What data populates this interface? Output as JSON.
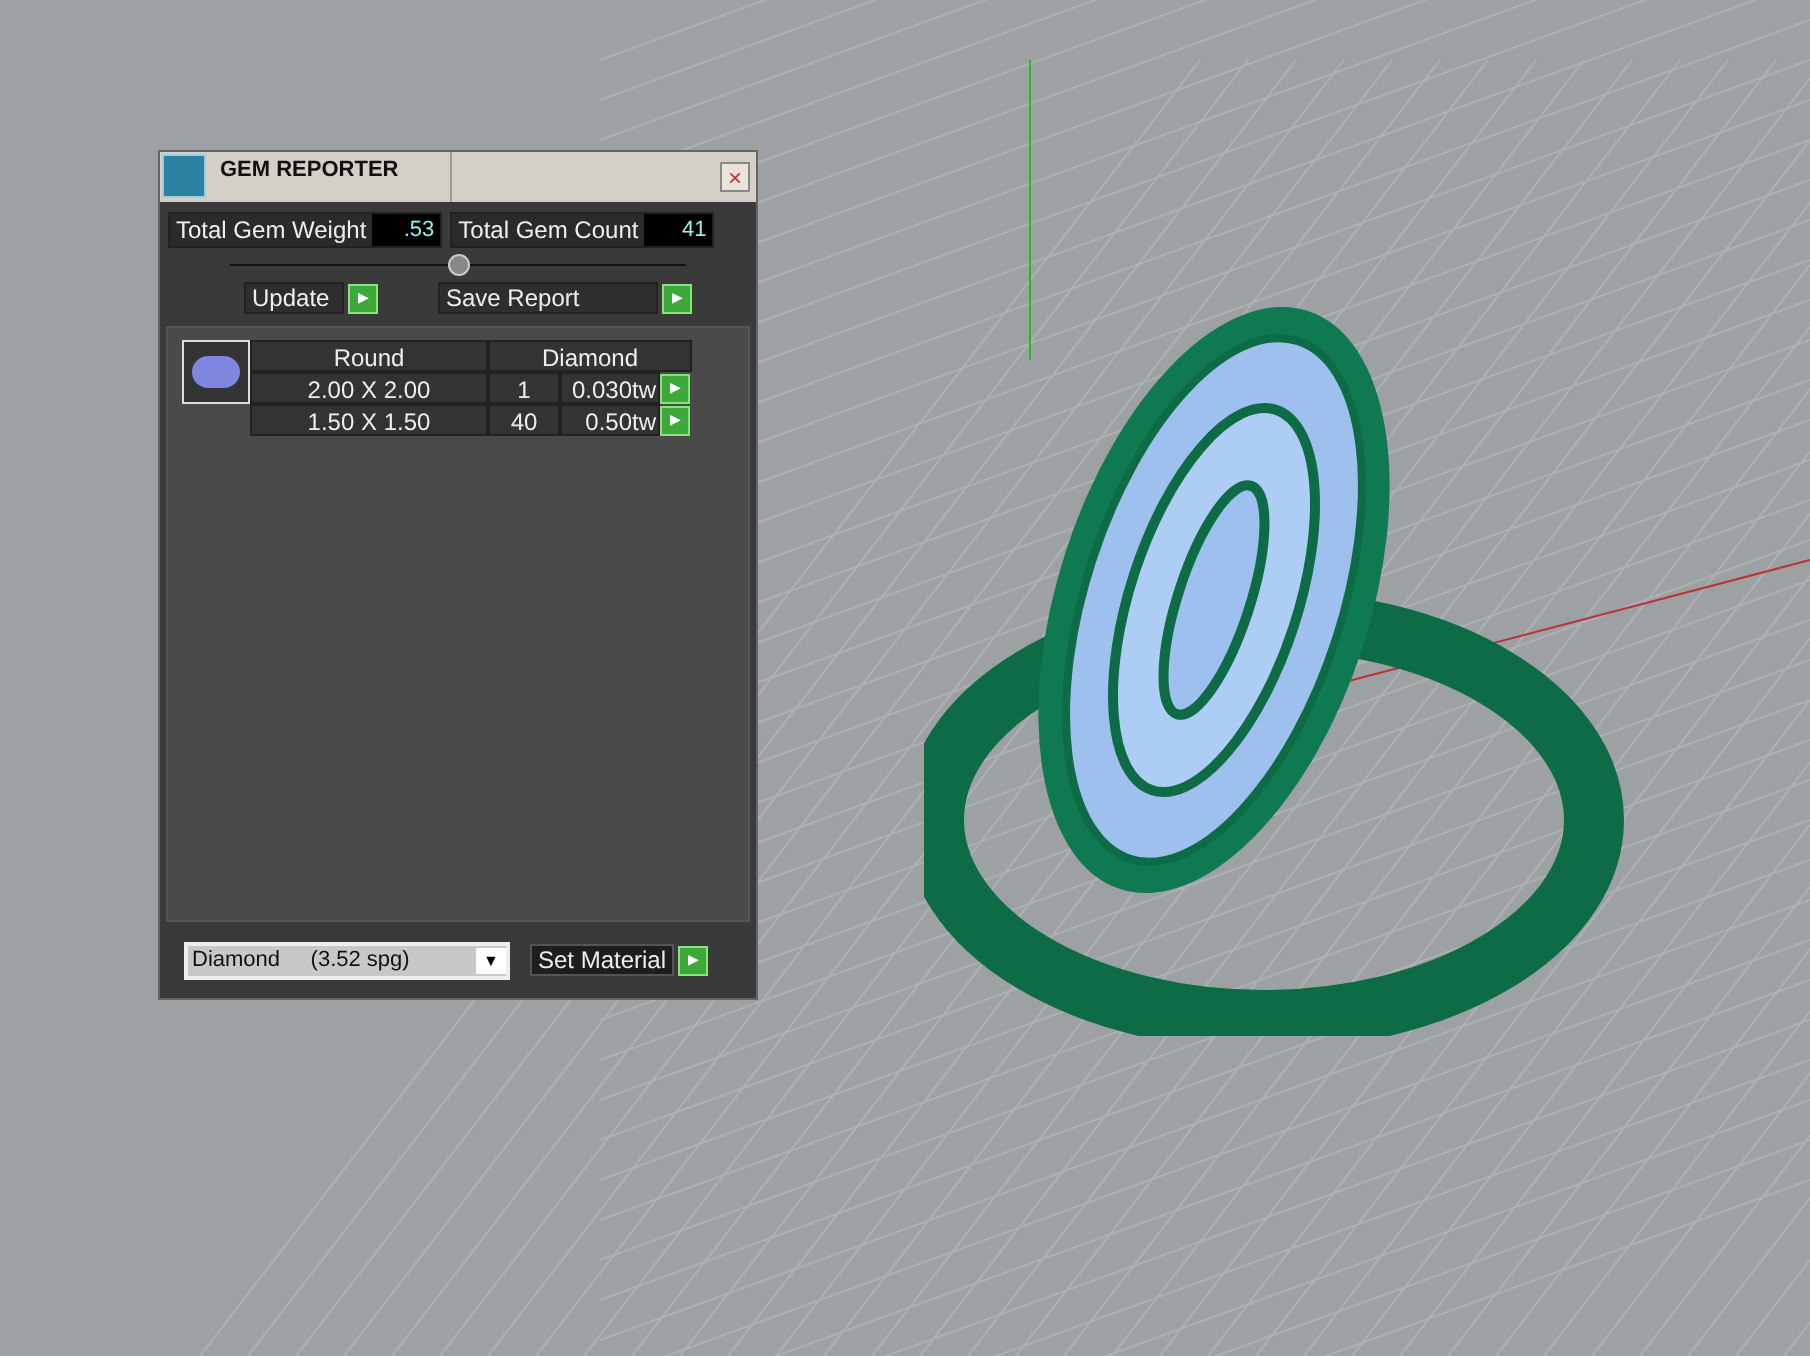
{
  "panel": {
    "title": "GEM REPORTER",
    "close": "×"
  },
  "totals": [
    {
      "label": "Total Gem Weight",
      "value": ".53"
    },
    {
      "label": "Total Gem Count",
      "value": "41"
    }
  ],
  "buttons": [
    {
      "label": "Update",
      "arrow": "▶"
    },
    {
      "label": "Save Report",
      "arrow": "▶"
    }
  ],
  "table": {
    "columns": [
      "Round",
      "Diamond"
    ],
    "rows": [
      {
        "size": "2.00 X 2.00",
        "count": "1",
        "weight": "0.030tw",
        "arrow": "▶"
      },
      {
        "size": "1.50 X 1.50",
        "count": "40",
        "weight": "0.50tw",
        "arrow": "▶"
      }
    ]
  },
  "material": {
    "value": "Diamond     (3.52 spg)",
    "caret": "▼"
  },
  "set_material": {
    "label": "Set Material",
    "arrow": "▶"
  }
}
